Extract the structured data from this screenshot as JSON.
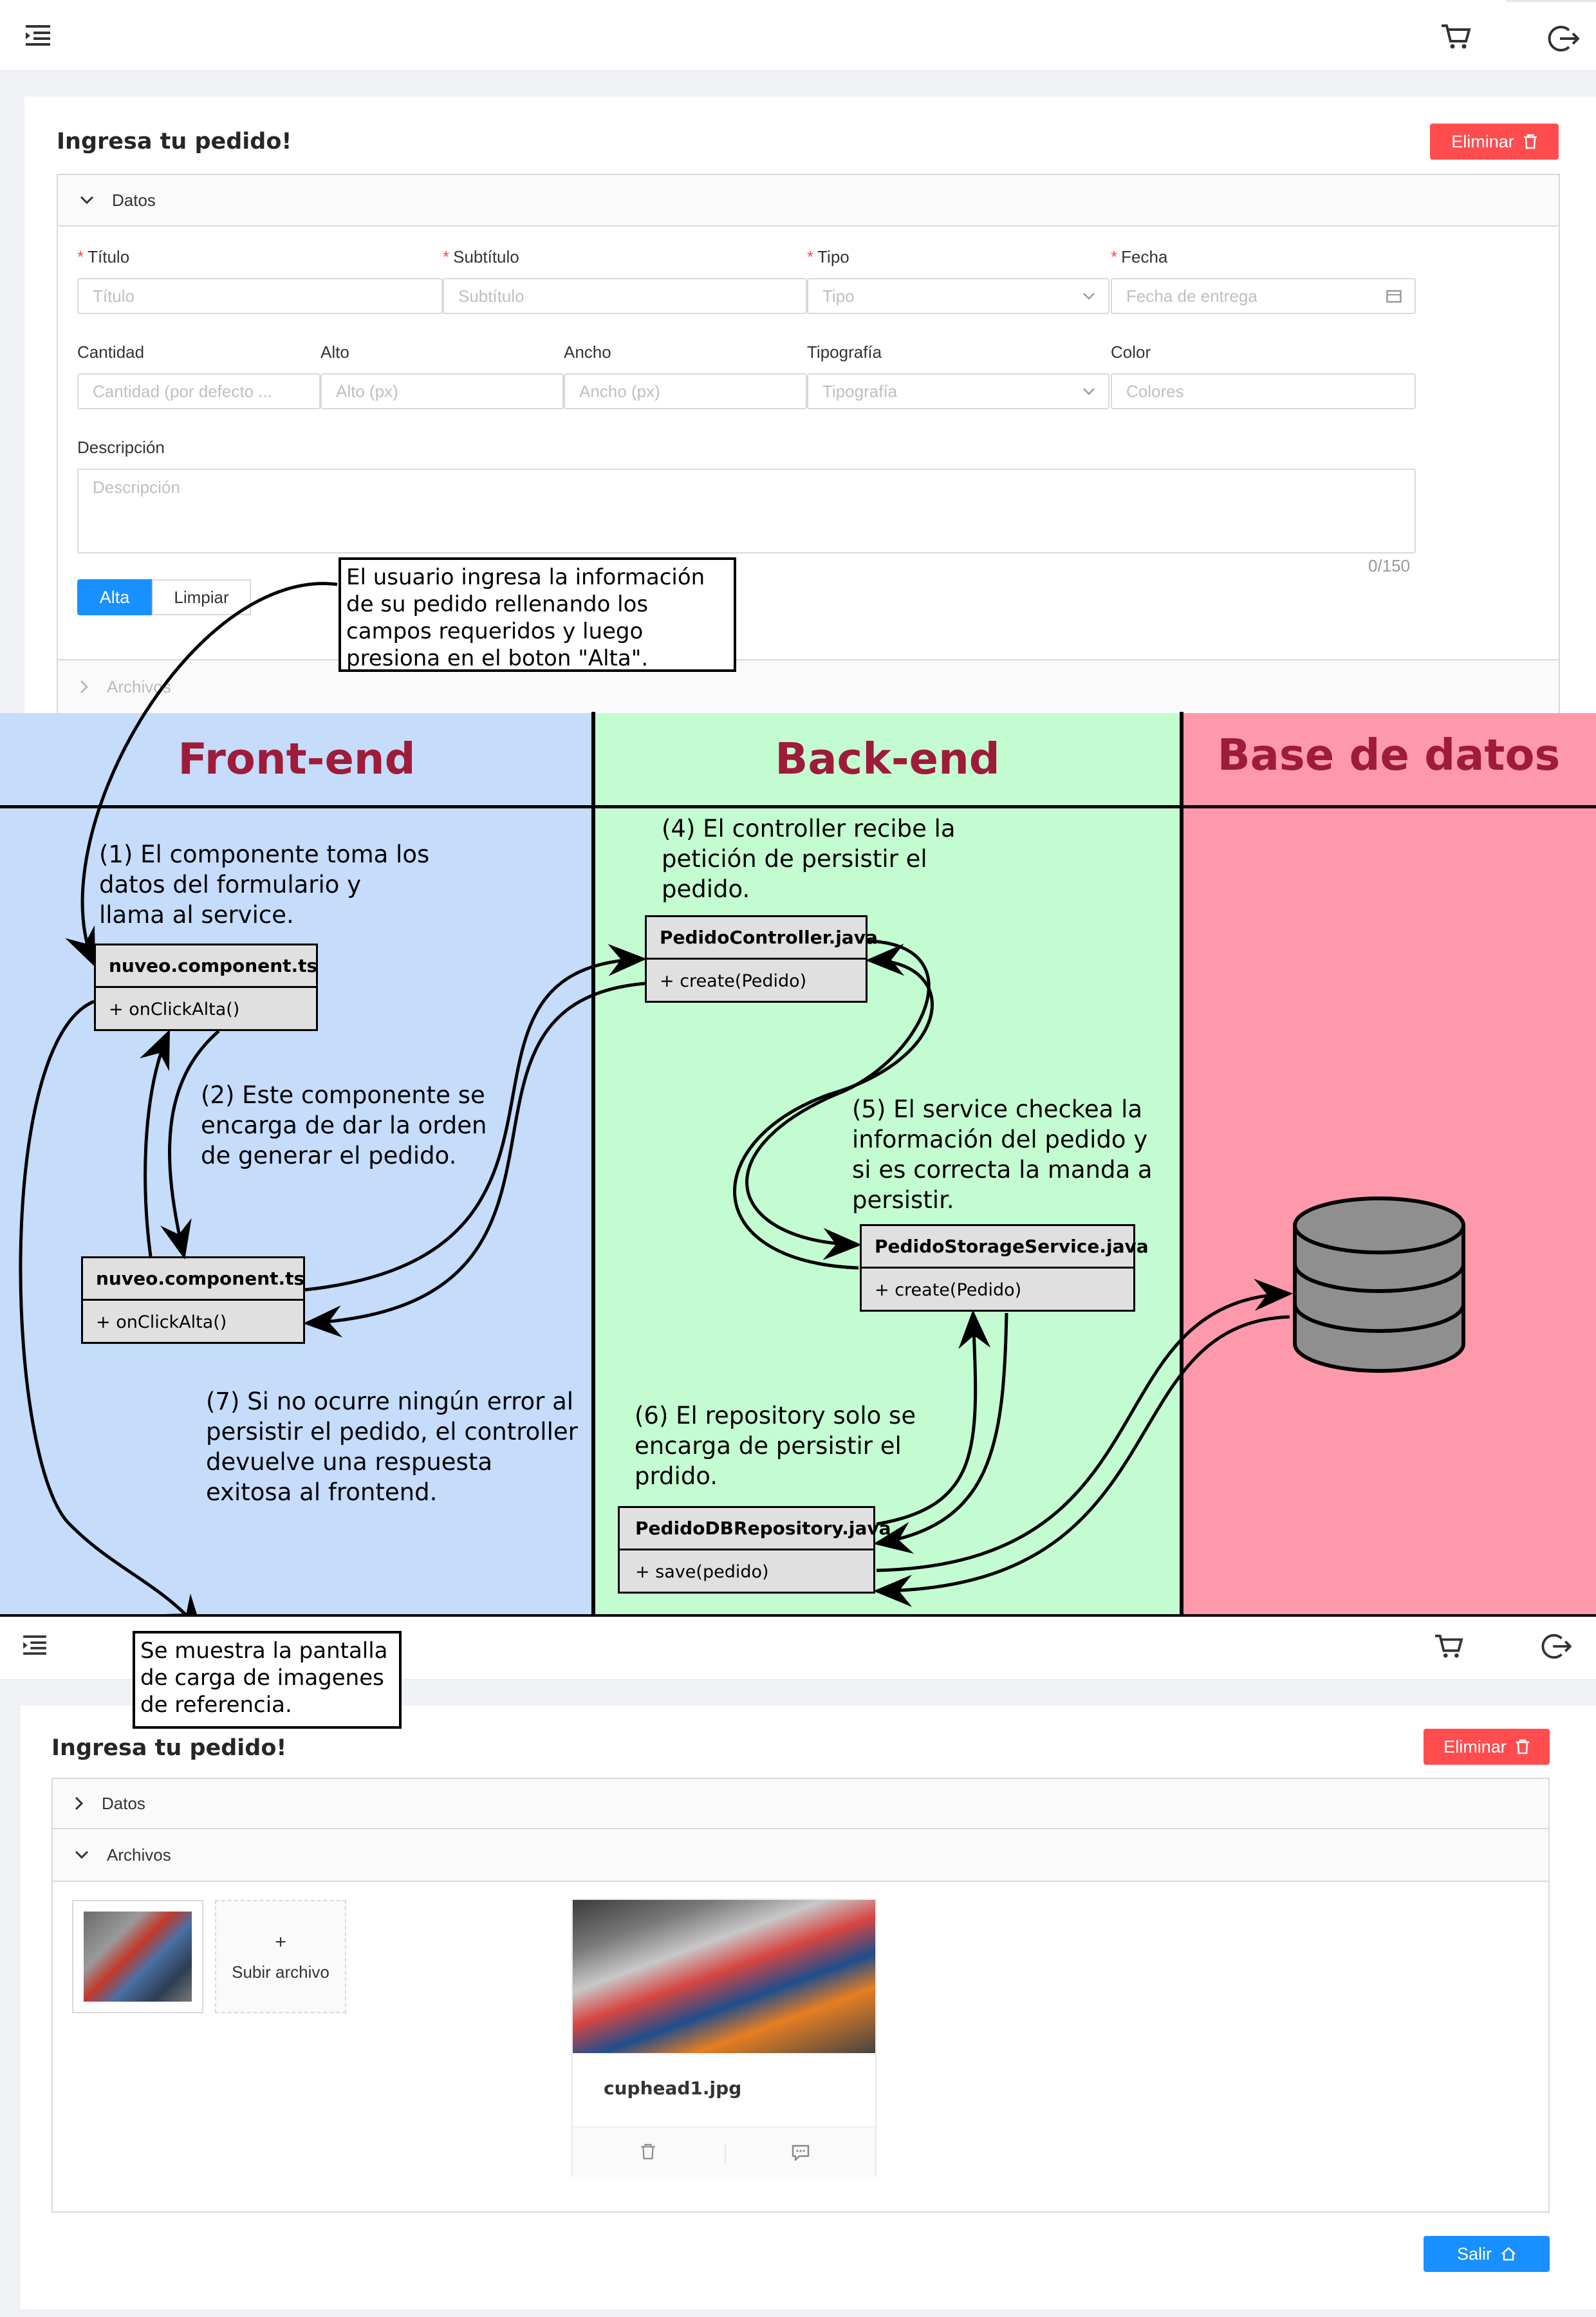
{
  "top_screen": {
    "form_title": "Ingresa tu pedido!",
    "delete_label": "Eliminar",
    "panel_data_label": "Datos",
    "panel_files_label": "Archivos",
    "fields": {
      "titulo": {
        "label": "Título",
        "placeholder": "Título",
        "required": true
      },
      "subtitulo": {
        "label": "Subtítulo",
        "placeholder": "Subtítulo",
        "required": true
      },
      "tipo": {
        "label": "Tipo",
        "placeholder": "Tipo",
        "required": true
      },
      "fecha": {
        "label": "Fecha",
        "placeholder": "Fecha de entrega",
        "required": true
      },
      "cantidad": {
        "label": "Cantidad",
        "placeholder": "Cantidad (por defecto ..."
      },
      "alto": {
        "label": "Alto",
        "placeholder": "Alto (px)"
      },
      "ancho": {
        "label": "Ancho",
        "placeholder": "Ancho (px)"
      },
      "tipografia": {
        "label": "Tipografía",
        "placeholder": "Tipografía"
      },
      "color": {
        "label": "Color",
        "placeholder": "Colores"
      },
      "descripcion": {
        "label": "Descripción",
        "placeholder": "Descripción",
        "counter": "0/150"
      }
    },
    "submit_label": "Alta",
    "clear_label": "Limpiar"
  },
  "diagram": {
    "columns": {
      "frontend": "Front-end",
      "backend": "Back-end",
      "database": "Base de datos"
    },
    "column_colors": {
      "frontend": "#c5dcfb",
      "backend": "#c4fcd2",
      "database": "#fe99ab",
      "heading_text": "#9e1b3a"
    },
    "callouts": {
      "user_input": "El usuario ingresa la información de su pedido rellenando los campos requeridos y luego presiona en el boton \"Alta\".",
      "upload_screen": "Se muestra la pantalla de carga de imagenes de referencia."
    },
    "steps": {
      "s1": "(1) El componente toma los datos del formulario y llama al service.",
      "s2": "(2) Este componente se encarga de dar la orden de generar el pedido.",
      "s4": "(4) El controller recibe la petición de persistir el pedido.",
      "s5": "(5) El service checkea la información del pedido y si es correcta la manda a persistir.",
      "s6": "(6) El repository solo se encarga de persistir el prdido.",
      "s7": "(7) Si no ocurre ningún error al persistir el pedido, el controller devuelve una respuesta exitosa al frontend."
    },
    "classes": {
      "component_a": {
        "name": "nuveo.component.ts",
        "method": "+ onClickAlta()"
      },
      "component_b": {
        "name": "nuveo.component.ts",
        "method": "+ onClickAlta()"
      },
      "controller": {
        "name": "PedidoController.java",
        "method": "+ create(Pedido)"
      },
      "service": {
        "name": "PedidoStorageService.java",
        "method": "+ create(Pedido)"
      },
      "repository": {
        "name": "PedidoDBRepository.java",
        "method": "+ save(pedido)"
      }
    }
  },
  "bottom_screen": {
    "form_title": "Ingresa tu pedido!",
    "delete_label": "Eliminar",
    "panel_data_label": "Datos",
    "panel_files_label": "Archivos",
    "upload_plus": "+",
    "upload_label": "Subir archivo",
    "file_name": "cuphead1.jpg",
    "exit_label": "Salir"
  }
}
